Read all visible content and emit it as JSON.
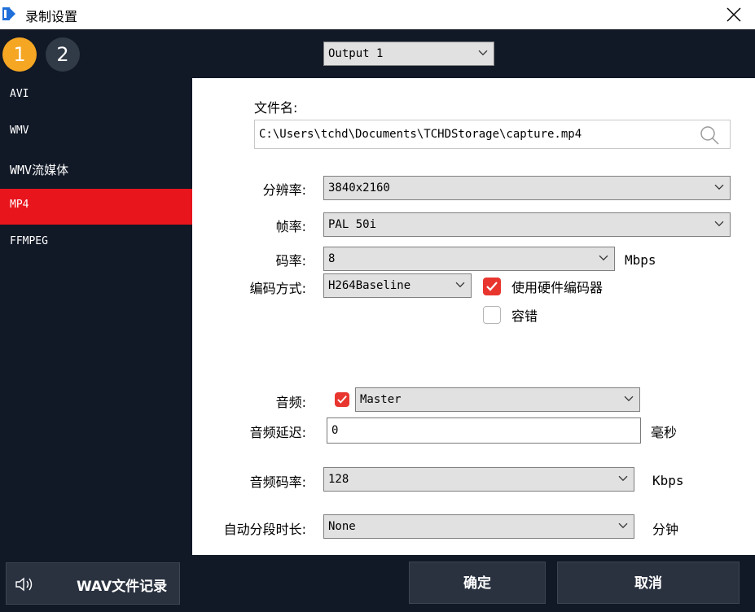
{
  "window": {
    "title": "录制设置"
  },
  "steps": [
    "1",
    "2"
  ],
  "output_select": {
    "value": "Output 1"
  },
  "sidebar": {
    "items": [
      {
        "label": "AVI"
      },
      {
        "label": "WMV"
      },
      {
        "label": "WMV流媒体"
      },
      {
        "label": "MP4",
        "active": true
      },
      {
        "label": "FFMPEG"
      }
    ]
  },
  "form": {
    "filename_label": "文件名:",
    "filename_value": "C:\\Users\\tchd\\Documents\\TCHDStorage\\capture.mp4",
    "resolution_label": "分辨率:",
    "resolution_value": "3840x2160",
    "framerate_label": "帧率:",
    "framerate_value": "PAL 50i",
    "bitrate_label": "码率:",
    "bitrate_value": "8",
    "bitrate_unit": "Mbps",
    "encoding_label": "编码方式:",
    "encoding_value": "H264Baseline",
    "hw_encoder_label": "使用硬件编码器",
    "hw_encoder_checked": true,
    "fault_tolerance_label": "容错",
    "fault_tolerance_checked": false,
    "audio_label": "音频:",
    "audio_checked": true,
    "audio_value": "Master",
    "audio_delay_label": "音频延迟:",
    "audio_delay_value": "0",
    "audio_delay_unit": "毫秒",
    "audio_bitrate_label": "音频码率:",
    "audio_bitrate_value": "128",
    "audio_bitrate_unit": "Kbps",
    "auto_segment_label": "自动分段时长:",
    "auto_segment_value": "None",
    "auto_segment_unit": "分钟"
  },
  "footer": {
    "wav_label": "WAV文件记录",
    "ok_label": "确定",
    "cancel_label": "取消"
  },
  "colors": {
    "accent_red": "#e8151d",
    "step_active": "#f5a623",
    "dark_bg": "#111826",
    "button_bg": "#2a3240"
  },
  "icons": [
    "app-icon",
    "close-icon",
    "chevron-down-icon",
    "search-icon",
    "speaker-icon"
  ]
}
